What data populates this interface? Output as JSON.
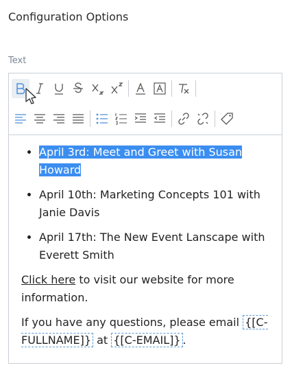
{
  "panel": {
    "title": "Configuration Options"
  },
  "field": {
    "label": "Text"
  },
  "toolbar": {
    "row1": [
      "bold-icon",
      "italic-icon",
      "underline-icon",
      "strikethrough-icon",
      "subscript-icon",
      "superscript-icon",
      "font-color-icon",
      "background-color-icon",
      "clear-formatting-icon"
    ],
    "row2": [
      "align-left-icon",
      "align-center-icon",
      "align-right-icon",
      "justify-icon",
      "bulleted-list-icon",
      "numbered-list-icon",
      "increase-indent-icon",
      "decrease-indent-icon",
      "link-icon",
      "unlink-icon",
      "tag-icon"
    ],
    "active": "bold-icon",
    "accent": "#3b8ef0"
  },
  "content": {
    "items": [
      "April 3rd: Meet and Greet with Susan Howard",
      "April 10th: Marketing Concepts 101 with Janie Davis",
      "April 17th: The New Event Lanscape with Everett Smith"
    ],
    "link_text": "Click here",
    "link_suffix": " to visit our website for more information.",
    "contact_prefix": "If you have any questions, please email ",
    "merge_name": "{[C-FULLNAME]}",
    "contact_mid": " at ",
    "merge_email": "{[C-EMAIL]}",
    "contact_suffix": "."
  }
}
